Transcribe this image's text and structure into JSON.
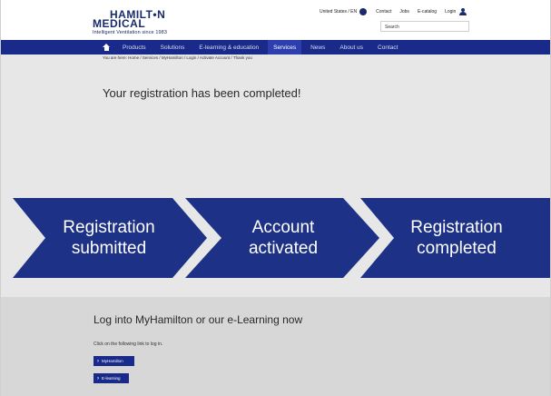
{
  "header": {
    "logo_line1": "HAMILT•N",
    "logo_line2": "MEDICAL",
    "tagline": "Intelligent Ventilation since 1983",
    "region": "United States / EN",
    "links": [
      "Contact",
      "Jobs",
      "E-catalog",
      "Login"
    ],
    "search_placeholder": "Search"
  },
  "nav": {
    "items": [
      "Products",
      "Solutions",
      "E-learning & education",
      "Services",
      "News",
      "About us",
      "Contact"
    ],
    "active": "Services"
  },
  "breadcrumb": "You are here: Home / Services / MyHamilton / Login / Activate Account / Thank you",
  "main": {
    "headline": "Your registration has been completed!",
    "steps": [
      {
        "line1": "Registration",
        "line2": "submitted"
      },
      {
        "line1": "Account",
        "line2": "activated"
      },
      {
        "line1": "Registration",
        "line2": "completed"
      }
    ]
  },
  "lower": {
    "title": "Log into MyHamilton or our e-Learning now",
    "text": "Click on the following link to log in.",
    "buttons": [
      "MyHamilton",
      "E-learning"
    ]
  },
  "colors": {
    "brand_navy": "#1a2a6c",
    "nav_blue": "#1a2a8a",
    "step_blue": "#1d3186",
    "bg_light": "#e7e7e7",
    "bg_lower": "#d7d7d7"
  }
}
